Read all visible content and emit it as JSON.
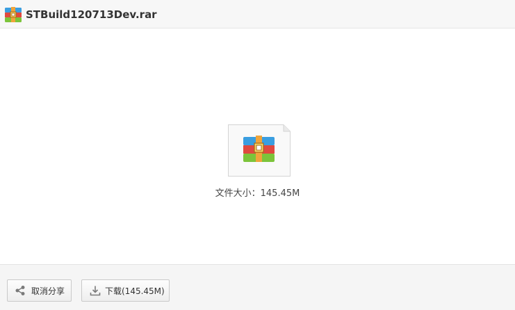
{
  "header": {
    "title": "STBuild120713Dev.rar",
    "icon": "winrar-archive-icon"
  },
  "file": {
    "icon": "winrar-archive-icon",
    "size_label": "文件大小：145.45M"
  },
  "footer": {
    "share_button": {
      "label": "取消分享",
      "icon": "share-icon"
    },
    "download_button": {
      "label": "下载(145.45M)",
      "icon": "download-icon"
    }
  },
  "colors": {
    "header_bg": "#f7f7f7",
    "footer_bg": "#f5f5f5",
    "archive_blue": "#3a9ee0",
    "archive_red": "#e0493f",
    "archive_green": "#7cc43a",
    "archive_strap": "#f0a43a"
  }
}
